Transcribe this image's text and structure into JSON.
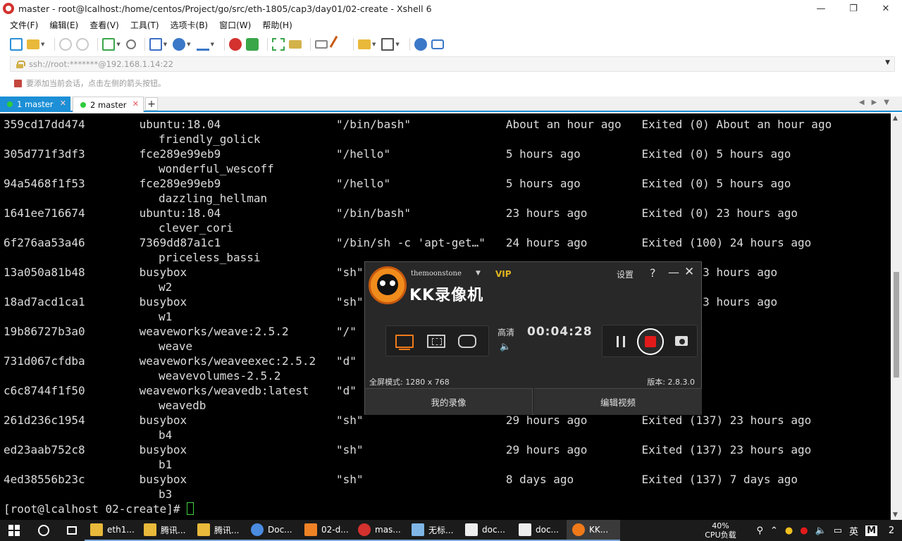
{
  "window": {
    "title": "master - root@lcalhost:/home/centos/Project/go/src/eth-1805/cap3/day01/02-create - Xshell 6",
    "controls": [
      "—",
      "❐",
      "✕"
    ]
  },
  "menu": [
    "文件(F)",
    "编辑(E)",
    "查看(V)",
    "工具(T)",
    "选项卡(B)",
    "窗口(W)",
    "帮助(H)"
  ],
  "address": {
    "value": "ssh://root:*******@192.168.1.14:22"
  },
  "hint": "要添加当前会话，点击左侧的箭头按钮。",
  "tabs": [
    {
      "label": "1 master",
      "active": true
    },
    {
      "label": "2 master",
      "active": false
    }
  ],
  "tab_add": "+",
  "terminal": {
    "rows": [
      {
        "line": "359cd17dd474        ubuntu:18.04                 \"/bin/bash\"              About an hour ago   Exited (0) About an hour ago",
        "name": "friendly_golick"
      },
      {
        "line": "305d771f3df3        fce289e99eb9                 \"/hello\"                 5 hours ago         Exited (0) 5 hours ago",
        "name": "wonderful_wescoff"
      },
      {
        "line": "94a5468f1f53        fce289e99eb9                 \"/hello\"                 5 hours ago         Exited (0) 5 hours ago",
        "name": "dazzling_hellman"
      },
      {
        "line": "1641ee716674        ubuntu:18.04                 \"/bin/bash\"              23 hours ago        Exited (0) 23 hours ago",
        "name": "clever_cori"
      },
      {
        "line": "6f276aa53a46        7369dd87a1c1                 \"/bin/sh -c 'apt-get…\"   24 hours ago        Exited (100) 24 hours ago",
        "name": "priceless_bassi"
      },
      {
        "line": "13a050a81b48        busybox                      \"sh\"                                         d (255) 23 hours ago",
        "name": "w2"
      },
      {
        "line": "18ad7acd1ca1        busybox                      \"sh\"                                         d (255) 23 hours ago",
        "name": "w1"
      },
      {
        "line": "19b86727b3a0        weaveworks/weave:2.5.2       \"/\"                                          hours",
        "name": "weave"
      },
      {
        "line": "731d067cfdba        weaveworks/weaveexec:2.5.2   \"d\"                                          ed",
        "name": "weavevolumes-2.5.2"
      },
      {
        "line": "c6c8744f1f50        weaveworks/weavedb:latest    \"d\"                                          ed",
        "name": "weavedb"
      },
      {
        "line": "261d236c1954        busybox                      \"sh\"                     29 hours ago        Exited (137) 23 hours ago",
        "name": "b4"
      },
      {
        "line": "ed23aab752c8        busybox                      \"sh\"                     29 hours ago        Exited (137) 23 hours ago",
        "name": "b1"
      },
      {
        "line": "4ed38556b23c        busybox                      \"sh\"                     8 days ago          Exited (137) 7 days ago",
        "name": "b3"
      }
    ],
    "prompt": "[root@lcalhost 02-create]# "
  },
  "kk": {
    "user": "themoonstone",
    "vip": "VIP",
    "app_name": "KK录像机",
    "settings": "设置",
    "help": "?",
    "minimize": "—",
    "close": "✕",
    "quality": "高清",
    "timer": "00:04:28",
    "fullscreen_mode": "全屏模式: 1280 x 768",
    "version": "版本: 2.8.3.0",
    "my_recordings": "我的录像",
    "edit_video": "编辑视频",
    "accent_color": "#f07a1a",
    "record_color": "#e21a1a"
  },
  "taskbar": {
    "items": [
      {
        "label": "eth1...",
        "icon": "folder-icon",
        "color": "#e8b93a"
      },
      {
        "label": "腾讯...",
        "icon": "folder-icon",
        "color": "#e8b93a"
      },
      {
        "label": "腾讯...",
        "icon": "folder-icon",
        "color": "#e8b93a"
      },
      {
        "label": "Doc...",
        "icon": "chrome-icon",
        "color": "#4a8be0"
      },
      {
        "label": "02-d...",
        "icon": "sublime-icon",
        "color": "#f08226"
      },
      {
        "label": "mas...",
        "icon": "xshell-icon",
        "color": "#d3322f"
      },
      {
        "label": "无标...",
        "icon": "notepad-icon",
        "color": "#7fb6e6"
      },
      {
        "label": "doc...",
        "icon": "typora-icon",
        "color": "#eeeeee"
      },
      {
        "label": "doc...",
        "icon": "typora-icon",
        "color": "#eeeeee"
      },
      {
        "label": "KK...",
        "icon": "kk-icon",
        "color": "#f07a1a"
      }
    ],
    "cpu_value": "40%",
    "cpu_label": "CPU负载",
    "ime": "英",
    "notification_count": "2"
  }
}
